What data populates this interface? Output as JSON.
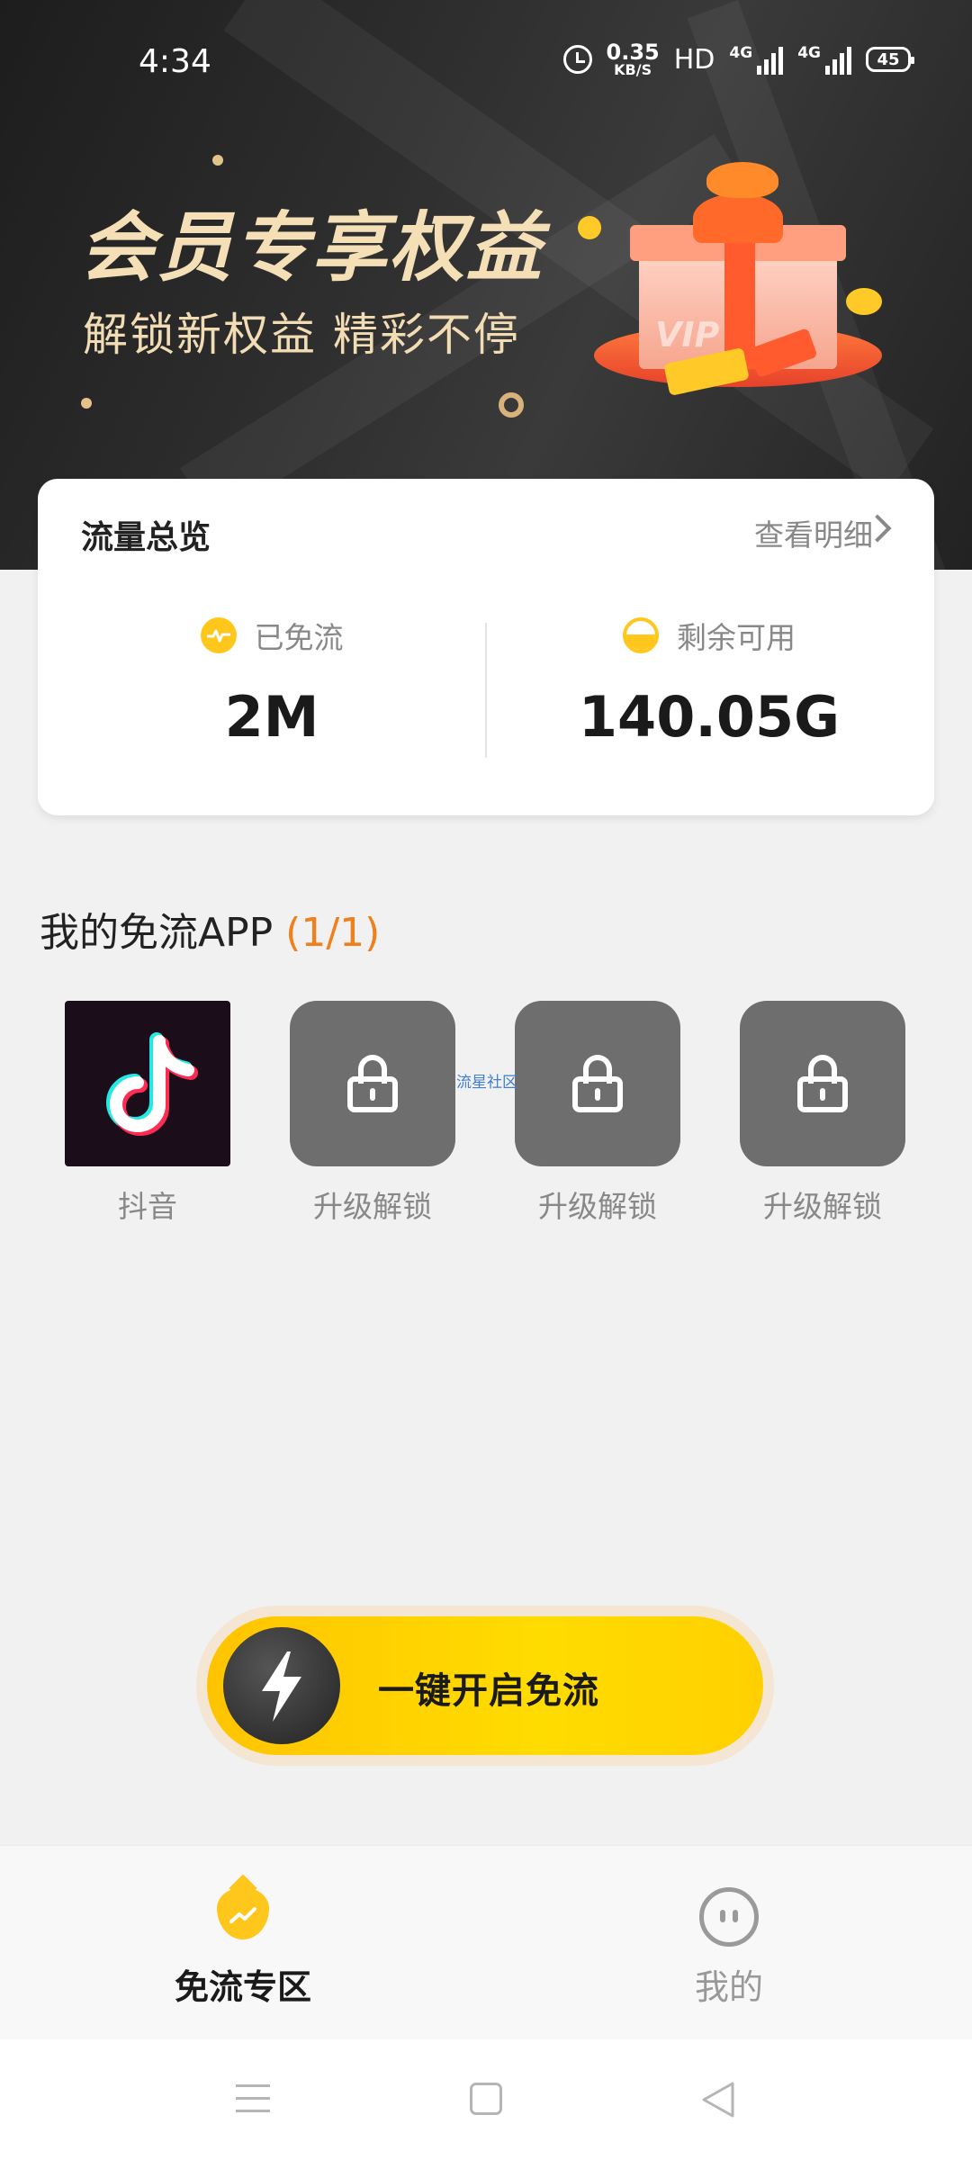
{
  "status_bar": {
    "time": "4:34",
    "net_speed_value": "0.35",
    "net_speed_unit": "KB/S",
    "hd_label": "HD",
    "sim1_label": "4G",
    "sim2_label": "4G",
    "battery": "45"
  },
  "banner": {
    "title": "会员专享权益",
    "subtitle": "解锁新权益  精彩不停",
    "vip_text": "VIP"
  },
  "traffic_card": {
    "title": "流量总览",
    "detail_link": "查看明细",
    "used": {
      "label": "已免流",
      "value": "2M",
      "icon": "pulse-icon"
    },
    "remaining": {
      "label": "剩余可用",
      "value": "140.05G",
      "icon": "half-fill-icon"
    }
  },
  "my_apps": {
    "title": "我的免流APP",
    "count": "(1/1)",
    "items": [
      {
        "name": "抖音",
        "icon": "douyin-app-icon"
      },
      {
        "name": "升级解锁",
        "icon": "lock-icon"
      },
      {
        "name": "升级解锁",
        "icon": "lock-icon"
      },
      {
        "name": "升级解锁",
        "icon": "lock-icon"
      }
    ]
  },
  "watermark": "流星社区",
  "cta": {
    "label": "一键开启免流",
    "icon": "lightning-bolt-icon"
  },
  "tab_bar": {
    "tabs": [
      {
        "label": "免流专区",
        "icon": "flow-drop-icon",
        "active": true
      },
      {
        "label": "我的",
        "icon": "smiley-face-icon",
        "active": false
      }
    ]
  },
  "colors": {
    "accent": "#ffc61b",
    "count_orange": "#f07f1c",
    "banner_gold": "#f4dfb7"
  }
}
